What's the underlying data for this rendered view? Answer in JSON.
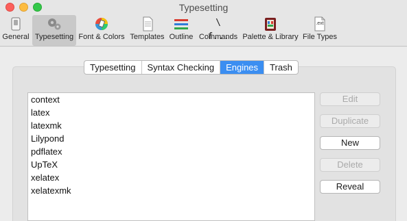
{
  "window": {
    "title": "Typesetting"
  },
  "toolbar": {
    "items": [
      {
        "label": "General",
        "icon": "switch-icon"
      },
      {
        "label": "Typesetting",
        "icon": "gears-icon",
        "selected": true
      },
      {
        "label": "Font & Colors",
        "icon": "color-wheel-icon"
      },
      {
        "label": "Templates",
        "icon": "document-icon"
      },
      {
        "label": "Outline",
        "icon": "outline-bars-icon"
      },
      {
        "label": "Commands",
        "icon": "backslash-f-icon",
        "glyph": "\\ f..."
      },
      {
        "label": "Palette & Library",
        "icon": "palette-library-icon"
      },
      {
        "label": "File Types",
        "icon": "file-ext-icon",
        "glyph": ".ext"
      }
    ]
  },
  "tabs": {
    "items": [
      "Typesetting",
      "Syntax Checking",
      "Engines",
      "Trash"
    ],
    "active": "Engines"
  },
  "engines": {
    "items": [
      "context",
      "latex",
      "latexmk",
      "Lilypond",
      "pdflatex",
      "UpTeX",
      "xelatex",
      "xelatexmk"
    ]
  },
  "buttons": {
    "edit": "Edit",
    "duplicate": "Duplicate",
    "new": "New",
    "delete": "Delete",
    "reveal": "Reveal"
  },
  "colors": {
    "accent": "#3b8ef1",
    "close": "#fc605c",
    "minimize": "#fdbc40",
    "maximize": "#34c84a"
  }
}
